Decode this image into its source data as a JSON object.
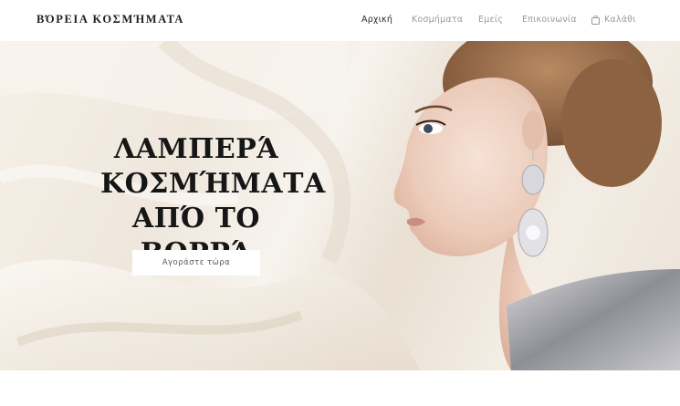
{
  "header": {
    "brand": "ΒΌΡΕΙΑ ΚΟΣΜΉΜΑΤΑ",
    "nav": [
      {
        "label": "Αρχική",
        "active": true
      },
      {
        "label": "Κοσμήματα",
        "active": false
      },
      {
        "label": "Εμείς",
        "active": false
      },
      {
        "label": "Επικοινωνία",
        "active": false
      }
    ],
    "cart": {
      "label": "Καλάθι",
      "icon": "shopping-bag-icon"
    }
  },
  "hero": {
    "title": "ΛΑΜΠΕΡΆ ΚΟΣΜΉΜΑΤΑ ΑΠΌ ΤΟ ΒΟΡΡΆ",
    "cta_label": "Αγοράστε τώρα",
    "image": "woman-with-diamond-earrings"
  },
  "colors": {
    "background": "#ffffff",
    "hero_cream": "#efe7dc",
    "title": "#161616",
    "nav_inactive": "#9a9a9a",
    "nav_active": "#2a2a2a"
  }
}
